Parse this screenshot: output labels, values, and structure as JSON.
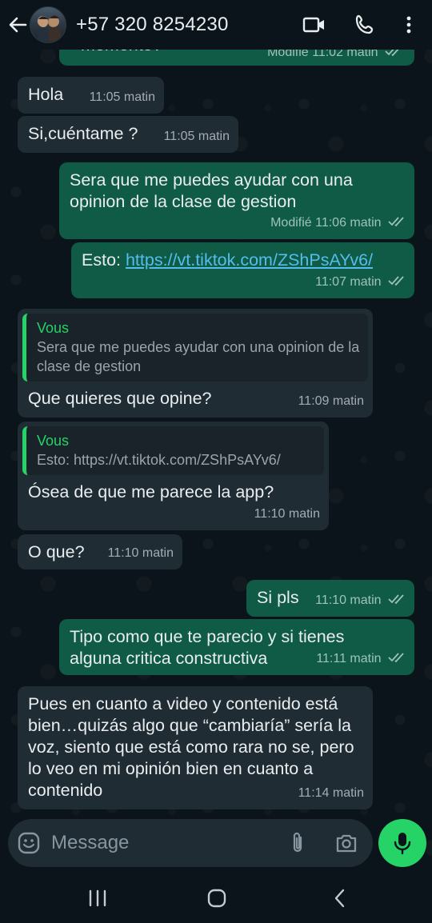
{
  "header": {
    "contact_name": "+57 320 8254230",
    "icons": [
      "back-arrow-icon",
      "video-call-icon",
      "voice-call-icon",
      "more-options-icon"
    ]
  },
  "messages": [
    {
      "dir": "out",
      "text": "momento?",
      "time": "Modifié 11:02 matin",
      "read": true,
      "partial": true
    },
    {
      "dir": "in",
      "text": "Hola",
      "time": "11:05 matin"
    },
    {
      "dir": "in",
      "text": "Si,cuéntame ?",
      "time": "11:05 matin"
    },
    {
      "dir": "out",
      "text": "Sera que me puedes ayudar con una opinion de la clase de gestion",
      "time": "Modifié 11:06 matin",
      "read": true
    },
    {
      "dir": "out",
      "text_prefix": "Esto: ",
      "link": "https://vt.tiktok.com/ZShPsAYv6/",
      "time": "11:07 matin",
      "read": true
    },
    {
      "dir": "in",
      "quote_name": "Vous",
      "quote_text": "Sera que me puedes ayudar con una opinion de la clase de gestion",
      "text": "Que quieres que opine?",
      "time": "11:09 matin"
    },
    {
      "dir": "in",
      "quote_name": "Vous",
      "quote_text": "Esto: https://vt.tiktok.com/ZShPsAYv6/",
      "text": "Ósea de que me parece la app?",
      "time": "11:10 matin"
    },
    {
      "dir": "in",
      "text": "O que?",
      "time": "11:10 matin"
    },
    {
      "dir": "out",
      "text": "Si pls",
      "time": "11:10 matin",
      "read": true
    },
    {
      "dir": "out",
      "text": "Tipo como que te parecio y si tienes alguna critica constructiva",
      "time": "11:11 matin",
      "read": true
    },
    {
      "dir": "in",
      "text": "Pues en cuanto a video y contenido está bien…quizás algo que “cambiaría” sería la voz, siento que está como rara no se, pero lo veo en mi opinión bien en cuanto a contenido",
      "time": "11:14 matin"
    }
  ],
  "composer": {
    "placeholder": "Message",
    "icons": [
      "emoji-icon",
      "attach-icon",
      "camera-icon",
      "microphone-icon"
    ]
  },
  "system_nav": {
    "icons": [
      "recent-apps-icon",
      "home-icon",
      "back-icon"
    ]
  },
  "colors": {
    "background": "#0b141a",
    "incoming_bubble": "#202c33",
    "outgoing_bubble": "#0f5b45",
    "accent_green": "#25d366",
    "link": "#53bdeb"
  }
}
